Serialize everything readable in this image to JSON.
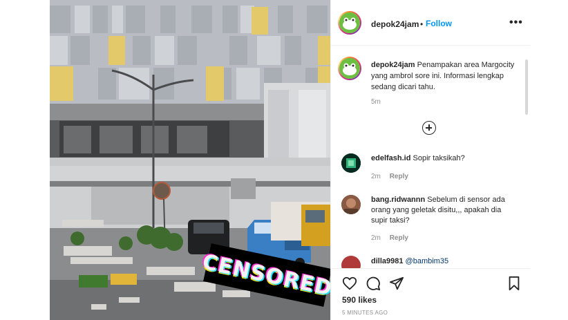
{
  "post": {
    "username": "depok24jam",
    "follow_label": "Follow",
    "separator": "•",
    "more_label": "•••",
    "caption_user": "depok24jam",
    "caption_text": "Penampakan area Margocity yang ambrol sore ini. Informasi lengkap sedang dicari tahu.",
    "caption_time": "5m",
    "censor_label": "CENSORED",
    "likes": "590 likes",
    "time_ago": "5 MINUTES AGO"
  },
  "comments": [
    {
      "user": "edelfash.id",
      "text": "Sopir taksikah?",
      "time": "2m",
      "reply": "Reply"
    },
    {
      "user": "bang.ridwannn",
      "text": "Sebelum di sensor ada orang yang geletak disitu,,, apakah dia supir taksi?",
      "time": "2m",
      "reply": "Reply"
    },
    {
      "user": "dilla9981",
      "text": "@bambim35"
    }
  ],
  "icons": {
    "like": "heart-icon",
    "comment": "comment-icon",
    "share": "paper-plane-icon",
    "save": "bookmark-icon",
    "load_more": "plus-circle-icon"
  },
  "colors": {
    "follow": "#0095f6",
    "muted": "#8e8e8e",
    "text": "#262626",
    "border": "#efefef"
  }
}
